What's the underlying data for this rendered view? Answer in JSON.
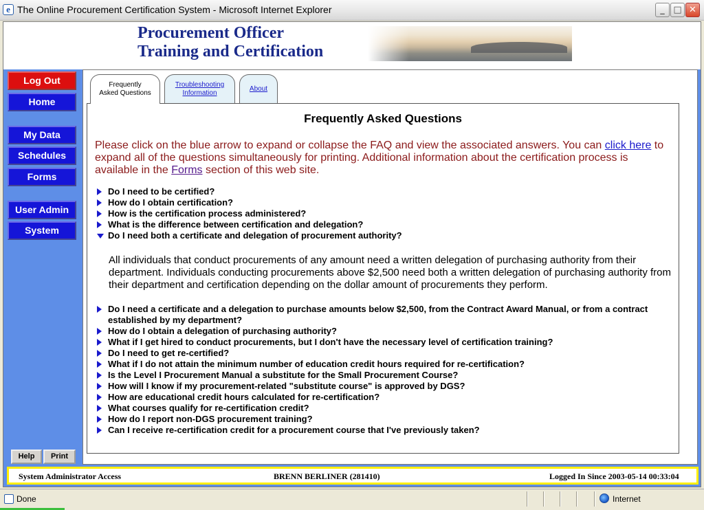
{
  "window": {
    "title": "The Online Procurement Certification System - Microsoft Internet Explorer",
    "min": "_",
    "max": "□",
    "close": "✕"
  },
  "header": {
    "title_line1": "Procurement Officer",
    "title_line2": "Training and Certification"
  },
  "nav": {
    "logout": "Log Out",
    "home": "Home",
    "my_data": "My Data",
    "schedules": "Schedules",
    "forms": "Forms",
    "user_admin": "User Admin",
    "system": "System",
    "help": "Help",
    "print": "Print"
  },
  "tabs": [
    {
      "line1": "Frequently",
      "line2": "Asked Questions",
      "active": true
    },
    {
      "line1": "Troubleshooting",
      "line2": "Information",
      "active": false
    },
    {
      "line1": "About",
      "line2": "",
      "active": false
    }
  ],
  "faq": {
    "heading": "Frequently Asked Questions",
    "intro_1": "Please click on the blue arrow to expand or collapse the FAQ and view the associated answers. You can ",
    "intro_link_1": "click here",
    "intro_2": " to expand all of the questions simultaneously for printing. Additional information about the certification process is available in the ",
    "intro_link_2": "Forms",
    "intro_3": " section of this web site.",
    "questions_top": [
      "Do I need to be certified?",
      "How do I obtain certification?",
      "How is the certification process administered?",
      "What is the difference between certification and delegation?",
      "Do I need both a certificate and delegation of procurement authority?"
    ],
    "answer": "All individuals that conduct procurements of any amount need a written delegation of purchasing authority from their department. Individuals conducting procurements above $2,500 need both a written delegation of purchasing authority from their department and certification depending on the dollar amount of procurements they perform.",
    "questions_bottom": [
      "Do I need a certificate and a delegation to purchase amounts below $2,500, from the Contract Award Manual, or from a contract established by my department?",
      "How do I obtain a delegation of purchasing authority?",
      "What if I get hired to conduct procurements, but I don't have the necessary level of certification training?",
      "Do I need to get re-certified?",
      "What if I do not attain the minimum number of education credit hours required for re-certification?",
      "Is the Level I Procurement Manual a substitute for the Small Procurement Course?",
      "How will I know if my procurement-related \"substitute course\" is approved by DGS?",
      "How are educational credit hours calculated for re-certification?",
      "What courses qualify for re-certification credit?",
      "How do I report non-DGS procurement training?",
      "Can I receive re-certification credit for a procurement course that I've previously taken?"
    ]
  },
  "footer": {
    "access": "System Administrator Access",
    "user": "BRENN BERLINER (281410)",
    "logged_in": "Logged In Since 2003-05-14 00:33:04"
  },
  "statusbar": {
    "status": "Done",
    "zone": "Internet"
  },
  "colors": {
    "nav_button": "#1515d8",
    "logout_button": "#dc0f0f",
    "sidebar_bg": "#5e8ee7",
    "intro_text": "#8b1a1a",
    "heading_brand": "#1a2a8a",
    "footer_border": "#ffee00"
  },
  "icons": {
    "window": "ie-icon",
    "collapsed": "arrow-right-icon",
    "expanded": "arrow-down-icon",
    "zone": "globe-icon"
  }
}
